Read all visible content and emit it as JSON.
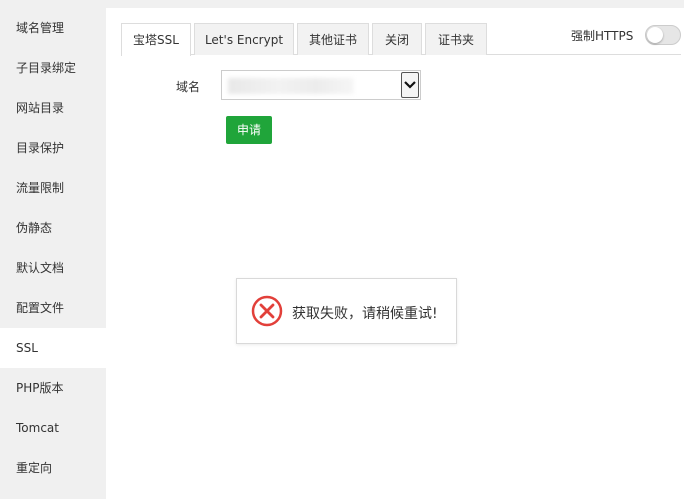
{
  "sidebar": {
    "items": [
      {
        "label": "域名管理"
      },
      {
        "label": "子目录绑定"
      },
      {
        "label": "网站目录"
      },
      {
        "label": "目录保护"
      },
      {
        "label": "流量限制"
      },
      {
        "label": "伪静态"
      },
      {
        "label": "默认文档"
      },
      {
        "label": "配置文件"
      },
      {
        "label": "SSL"
      },
      {
        "label": "PHP版本"
      },
      {
        "label": "Tomcat"
      },
      {
        "label": "重定向"
      }
    ],
    "active": "SSL"
  },
  "tabs": [
    {
      "label": "宝塔SSL"
    },
    {
      "label": "Let's Encrypt"
    },
    {
      "label": "其他证书"
    },
    {
      "label": "关闭"
    },
    {
      "label": "证书夹"
    }
  ],
  "force_https": {
    "label": "强制HTTPS",
    "enabled": false
  },
  "form": {
    "domain_label": "域名",
    "apply_label": "申请"
  },
  "toast": {
    "message": "获取失败，请稍候重试!",
    "icon": "error-circle-icon"
  },
  "colors": {
    "accent": "#20a53a",
    "error": "#e2403a",
    "sidebar_bg": "#f0f0f0"
  }
}
